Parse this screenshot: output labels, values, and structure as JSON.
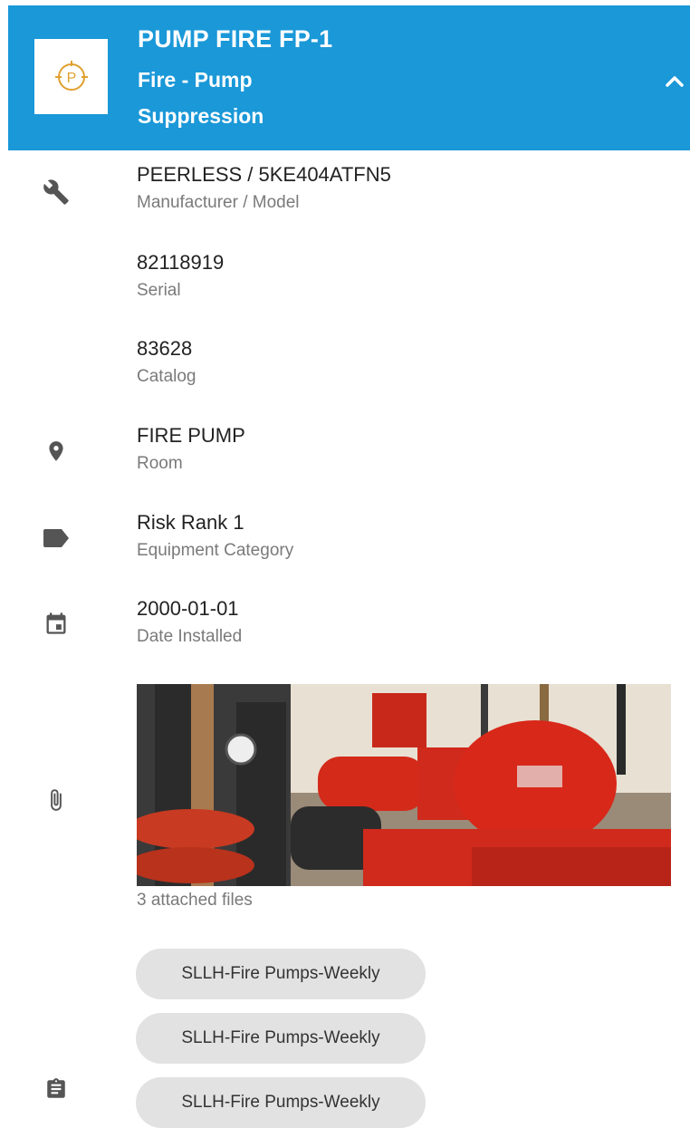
{
  "header": {
    "title": "PUMP FIRE FP-1",
    "subtitle": "Fire - Pump",
    "category": "Suppression",
    "logo_letter": "P",
    "color": "#1a98d8"
  },
  "details": [
    {
      "value": "PEERLESS / 5KE404ATFN5",
      "label": "Manufacturer / Model",
      "icon": "wrench-icon"
    },
    {
      "value": "82118919",
      "label": "Serial"
    },
    {
      "value": "83628",
      "label": "Catalog"
    },
    {
      "value": "FIRE PUMP",
      "label": "Room",
      "icon": "location-pin-icon"
    },
    {
      "value": "Risk Rank 1",
      "label": "Equipment Category",
      "icon": "tag-icon"
    },
    {
      "value": "2000-01-01",
      "label": "Date Installed",
      "icon": "calendar-icon"
    }
  ],
  "attachments": {
    "count_text": "3 attached files",
    "icon": "paperclip-icon"
  },
  "tasks": {
    "icon": "clipboard-icon",
    "chips": [
      "SLLH-Fire Pumps-Weekly",
      "SLLH-Fire Pumps-Weekly",
      "SLLH-Fire Pumps-Weekly"
    ]
  }
}
